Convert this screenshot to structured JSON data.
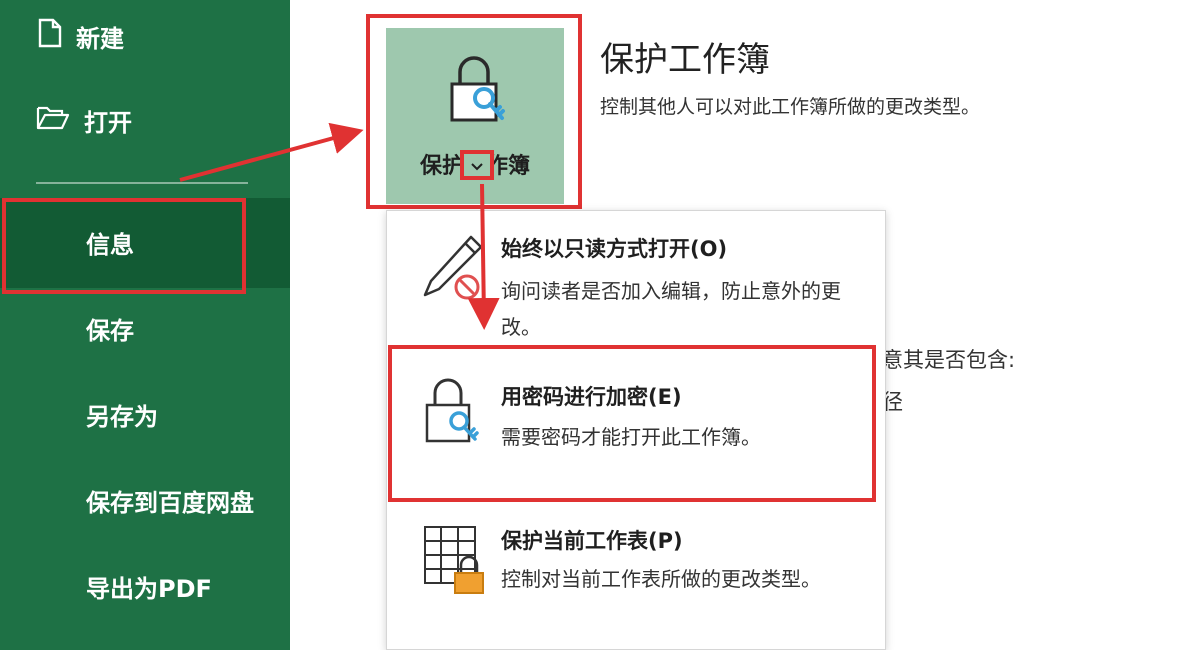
{
  "sidebar": {
    "items": [
      {
        "label": "新建",
        "icon": "new-file-icon"
      },
      {
        "label": "打开",
        "icon": "folder-open-icon"
      },
      {
        "label": "信息"
      },
      {
        "label": "保存"
      },
      {
        "label": "另存为"
      },
      {
        "label": "保存到百度网盘"
      },
      {
        "label": "导出为PDF"
      }
    ],
    "active_index": 2
  },
  "protect_button": {
    "label": "保护工作簿",
    "icon": "lock-key-icon"
  },
  "section": {
    "title": "保护工作簿",
    "description": "控制其他人可以对此工作簿所做的更改类型。"
  },
  "partially_hidden": {
    "line1": "意其是否包含:",
    "line2": "径"
  },
  "menu": {
    "items": [
      {
        "title": "始终以只读方式打开(O)",
        "description": "询问读者是否加入编辑，防止意外的更改。",
        "icon": "pencil-no-edit-icon"
      },
      {
        "title": "用密码进行加密(E)",
        "description": "需要密码才能打开此工作簿。",
        "icon": "lock-key-icon"
      },
      {
        "title": "保护当前工作表(P)",
        "description": "控制对当前工作表所做的更改类型。",
        "icon": "sheet-lock-icon"
      }
    ]
  },
  "colors": {
    "sidebar_bg": "#1e7145",
    "sidebar_active": "#125b34",
    "button_bg": "#9ec8ae",
    "highlight": "#e03232",
    "lock_key": "#3aa0d8",
    "lock_orange": "#f0a030"
  }
}
